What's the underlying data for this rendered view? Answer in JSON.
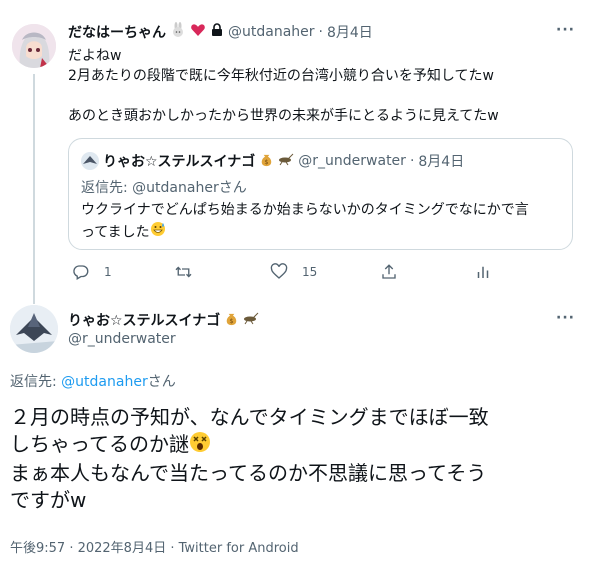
{
  "tweet1": {
    "display_name": "だなはーちゃん",
    "handle": "@utdanaher",
    "date": "8月4日",
    "lines": [
      "だよねw",
      "2月あたりの段階で既に今年秋付近の台湾小競り合いを予知してたw",
      "",
      "あのとき頭おかしかったから世界の未来が手にとるように見えてたw"
    ],
    "reply_count": "1",
    "retweet_count": "",
    "like_count": "15"
  },
  "quote": {
    "display_name": "りゃお☆ステルスイナゴ",
    "handle": "@r_underwater",
    "date": "8月4日",
    "reply_to_prefix": "返信先: ",
    "reply_to_handle": "@utdanaher",
    "reply_to_suffix": "さん",
    "text_line1": "ウクライナでどんぱち始まるか始まらないかのタイミングでなにかで言",
    "text_line2": "ってました"
  },
  "tweet2": {
    "display_name": "りゃお☆ステルスイナゴ",
    "handle": "@r_underwater",
    "reply_to_prefix": "返信先: ",
    "reply_to_handle": "@utdanaher",
    "reply_to_suffix": "さん",
    "line1": "２月の時点の予知が、なんでタイミングまでほぼ一致",
    "line2": "しちゃってるのか謎",
    "line3": "まぁ本人もなんで当たってるのか不思議に思ってそう",
    "line4": "ですがw",
    "timestamp": "午後9:57 · 2022年8月4日 · Twitter for Android"
  },
  "icons": [
    "rabbit-icon",
    "heart-icon",
    "lock-icon",
    "money-bag-icon",
    "cricket-icon",
    "reply-icon",
    "retweet-icon",
    "like-icon",
    "share-icon",
    "analytics-icon",
    "more-icon",
    "grin-sweat-emoji",
    "dizzy-face-emoji"
  ]
}
